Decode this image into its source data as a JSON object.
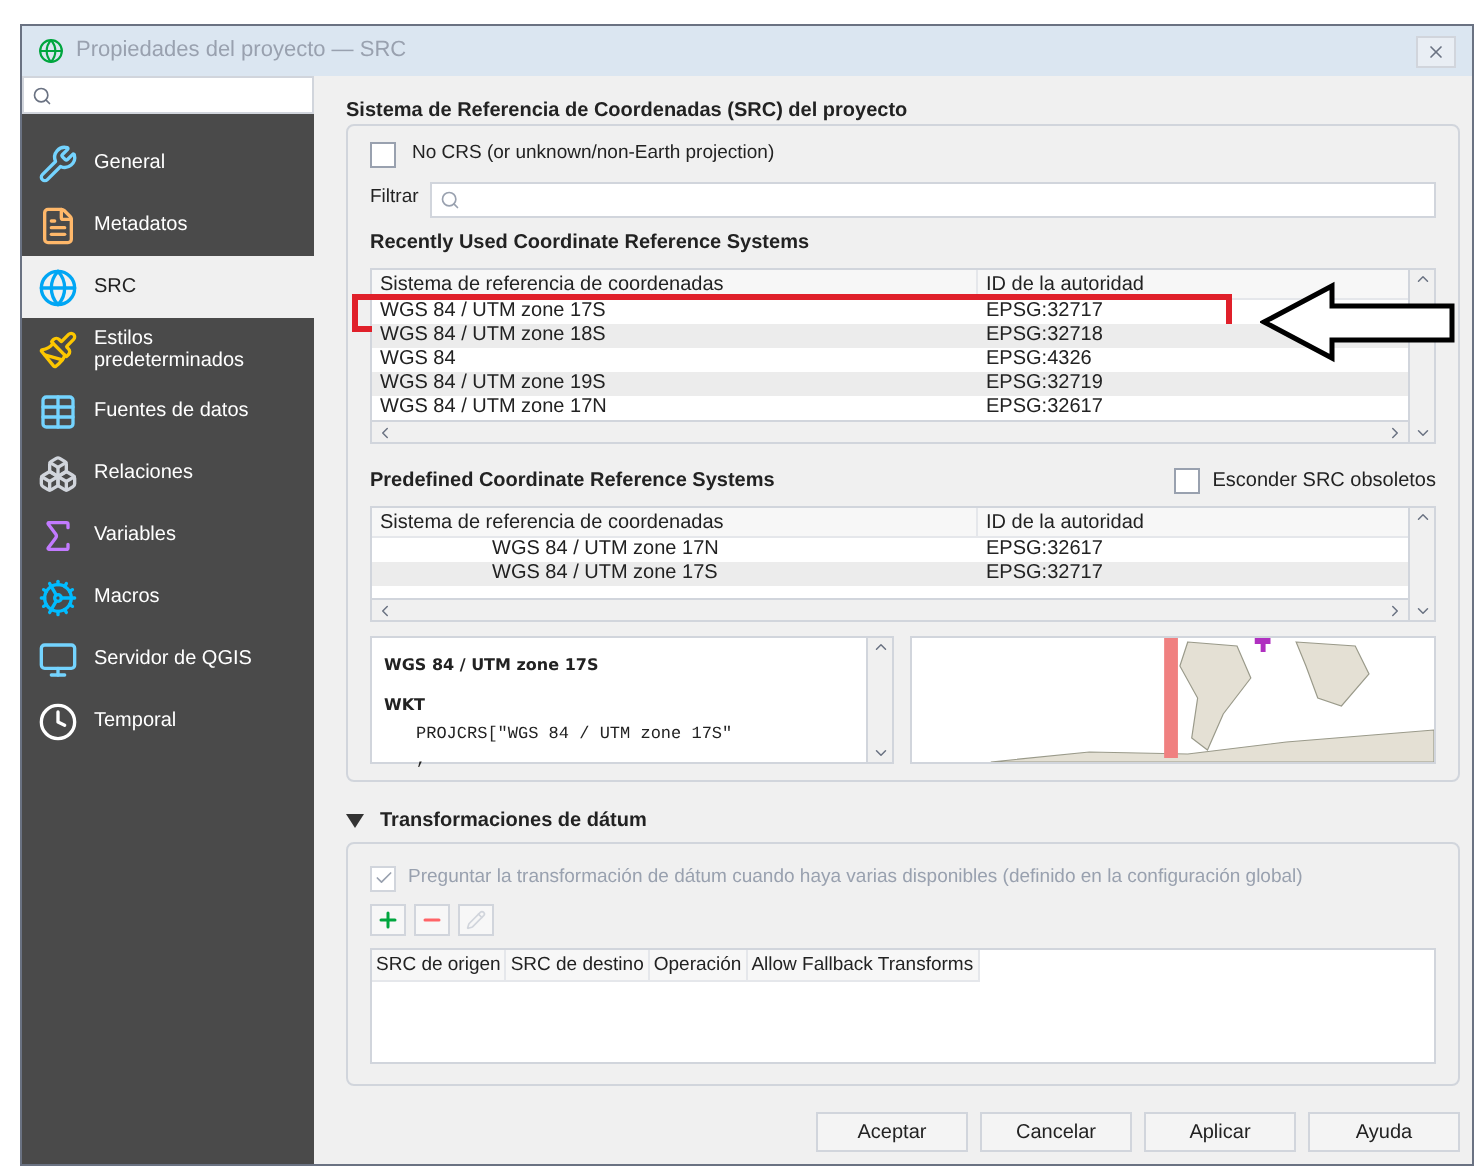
{
  "window": {
    "title": "Propiedades del proyecto — SRC"
  },
  "sidebar": {
    "items": [
      {
        "label": "General",
        "selected": false
      },
      {
        "label": "Metadatos",
        "selected": false
      },
      {
        "label": "SRC",
        "selected": true
      },
      {
        "label": "Estilos predeterminados",
        "selected": false
      },
      {
        "label": "Fuentes de datos",
        "selected": false
      },
      {
        "label": "Relaciones",
        "selected": false
      },
      {
        "label": "Variables",
        "selected": false
      },
      {
        "label": "Macros",
        "selected": false
      },
      {
        "label": "Servidor de QGIS",
        "selected": false
      },
      {
        "label": "Temporal",
        "selected": false
      }
    ]
  },
  "heading": "Sistema de Referencia de Coordenadas (SRC) del proyecto",
  "no_crs": {
    "label": "No CRS (or unknown/non-Earth projection)",
    "checked": false
  },
  "filter": {
    "label": "Filtrar"
  },
  "recent": {
    "title": "Recently Used Coordinate Reference Systems",
    "columns": [
      "Sistema de referencia de coordenadas",
      "ID de la autoridad"
    ],
    "rows": [
      {
        "name": "WGS 84 / UTM zone 17S",
        "id": "EPSG:32717",
        "highlighted": true
      },
      {
        "name": "WGS 84 / UTM zone 18S",
        "id": "EPSG:32718",
        "highlighted": false
      },
      {
        "name": "WGS 84",
        "id": "EPSG:4326",
        "highlighted": false
      },
      {
        "name": "WGS 84 / UTM zone 19S",
        "id": "EPSG:32719",
        "highlighted": false
      },
      {
        "name": "WGS 84 / UTM zone 17N",
        "id": "EPSG:32617",
        "highlighted": false
      }
    ]
  },
  "predefined": {
    "title": "Predefined Coordinate Reference Systems",
    "hide_obsolete": {
      "label": "Esconder SRC obsoletos",
      "checked": false
    },
    "columns": [
      "Sistema de referencia de coordenadas",
      "ID de la autoridad"
    ],
    "rows": [
      {
        "name": "WGS 84 / UTM zone 17N",
        "id": "EPSG:32617"
      },
      {
        "name": "WGS 84 / UTM zone 17S",
        "id": "EPSG:32717"
      }
    ]
  },
  "details": {
    "name": "WGS 84 / UTM zone 17S",
    "wkt_label": "WKT",
    "wkt_lines": [
      "PROJCRS[\"WGS 84 / UTM zone 17S\"",
      ","
    ]
  },
  "datum": {
    "title": "Transformaciones de dátum",
    "expanded": true,
    "ask": {
      "label": "Preguntar la transformación de dátum cuando haya varias disponibles (definido en la configuración global)",
      "checked": true,
      "disabled": true
    },
    "columns": [
      "SRC de origen",
      "SRC de destino",
      "Operación",
      "Allow Fallback Transforms"
    ]
  },
  "buttons": [
    "Aceptar",
    "Cancelar",
    "Aplicar",
    "Ayuda"
  ]
}
